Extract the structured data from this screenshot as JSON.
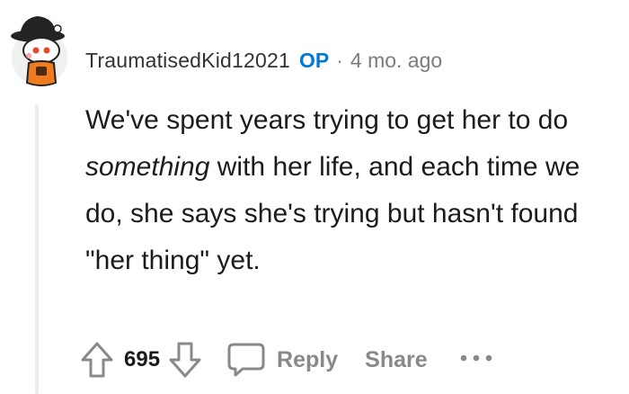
{
  "comment": {
    "username": "TraumatisedKid12021",
    "op_badge": "OP",
    "separator": "·",
    "age": "4 mo. ago",
    "body": {
      "before_emphasis": "We've spent years trying to get her to do ",
      "emphasis": "something",
      "after_emphasis": " with her life, and each time we do, she says she's trying but hasn't found \"her thing\" yet."
    }
  },
  "actions": {
    "score": "695",
    "reply_label": "Reply",
    "share_label": "Share"
  },
  "icons": {
    "avatar": "snoo-avatar-hat",
    "upvote": "arrow-up-outline",
    "downvote": "arrow-down-outline",
    "reply": "speech-bubble-outline",
    "more": "horizontal-ellipsis"
  },
  "colors": {
    "op_badge": "#0079d3",
    "muted": "#878a8c",
    "text": "#1a1a1b"
  }
}
